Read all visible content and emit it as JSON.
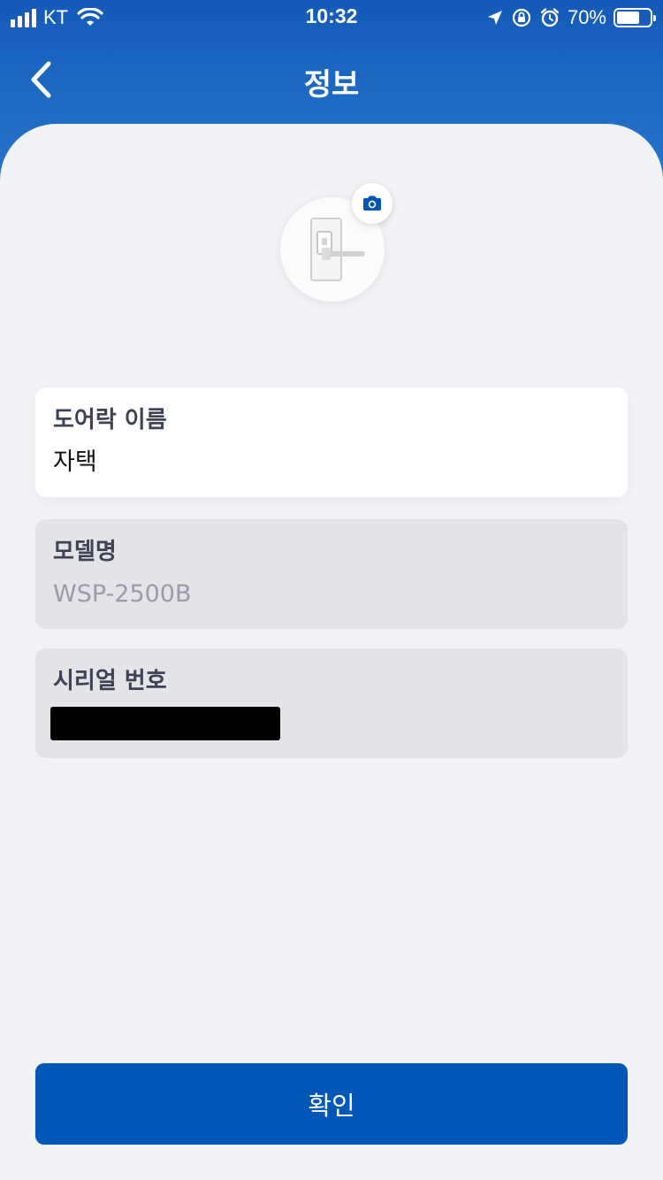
{
  "status_bar": {
    "carrier": "KT",
    "time": "10:32",
    "battery_percent": "70%",
    "battery_level": 0.7
  },
  "header": {
    "title": "정보",
    "back_icon": "chevron-left-icon"
  },
  "avatar": {
    "image_icon": "door-lock-icon",
    "camera_icon": "camera-icon"
  },
  "fields": {
    "door_lock_name": {
      "label": "도어락 이름",
      "value": "자택"
    },
    "model_name": {
      "label": "모델명",
      "value": "WSP-2500B"
    },
    "serial_number": {
      "label": "시리얼 번호"
    }
  },
  "confirm_button": {
    "label": "확인"
  },
  "colors": {
    "primary": "#0057b8",
    "header_gradient_top": "#1559b9",
    "background": "#f0f2f6",
    "readonly_card": "#e3e4e8"
  }
}
